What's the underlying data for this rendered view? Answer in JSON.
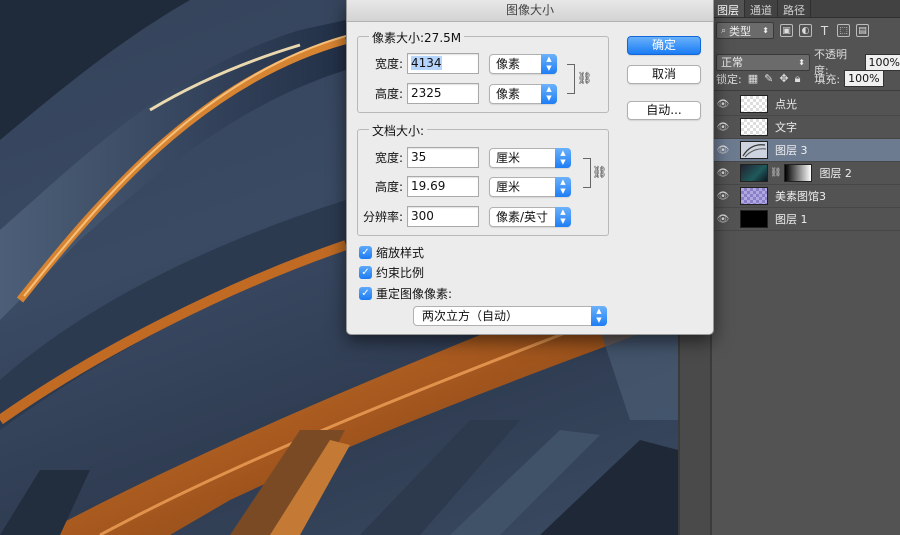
{
  "dialog": {
    "title": "图像大小",
    "pixel_dimensions": {
      "title": "像素大小:27.5M",
      "width_label": "宽度:",
      "width_value": "4134",
      "width_unit": "像素",
      "height_label": "高度:",
      "height_value": "2325",
      "height_unit": "像素"
    },
    "document_size": {
      "title": "文档大小:",
      "width_label": "宽度:",
      "width_value": "35",
      "width_unit": "厘米",
      "height_label": "高度:",
      "height_value": "19.69",
      "height_unit": "厘米",
      "resolution_label": "分辨率:",
      "resolution_value": "300",
      "resolution_unit": "像素/英寸"
    },
    "checkboxes": [
      {
        "label": "缩放样式",
        "checked": true
      },
      {
        "label": "约束比例",
        "checked": true
      },
      {
        "label": "重定图像像素:",
        "checked": true
      }
    ],
    "resample_method": "两次立方（自动）",
    "buttons": {
      "ok": "确定",
      "cancel": "取消",
      "auto": "自动..."
    }
  },
  "layers_panel": {
    "tabs": [
      "图层",
      "通道",
      "路径"
    ],
    "active_tab": "图层",
    "filter_kind": "类型",
    "blend_mode": "正常",
    "opacity_label": "不透明度:",
    "opacity_value": "100%",
    "lock_label": "锁定:",
    "fill_label": "填充:",
    "fill_value": "100%",
    "layers": [
      {
        "name": "点光",
        "thumb": "checker",
        "selected": false
      },
      {
        "name": "文字",
        "thumb": "checker",
        "selected": false
      },
      {
        "name": "图层 3",
        "thumb": "art",
        "selected": true
      },
      {
        "name": "图层 2",
        "thumb": "dark",
        "selected": false,
        "has_mask": true
      },
      {
        "name": "美素图馆3",
        "thumb": "purple",
        "selected": false
      },
      {
        "name": "图层 1",
        "thumb": "black",
        "selected": false
      }
    ]
  },
  "colors": {
    "accent": "#1a7cf4",
    "selected_layer": "#6d7b91",
    "copper": "#c2702a",
    "canvas_blue": "#3a4a63"
  }
}
